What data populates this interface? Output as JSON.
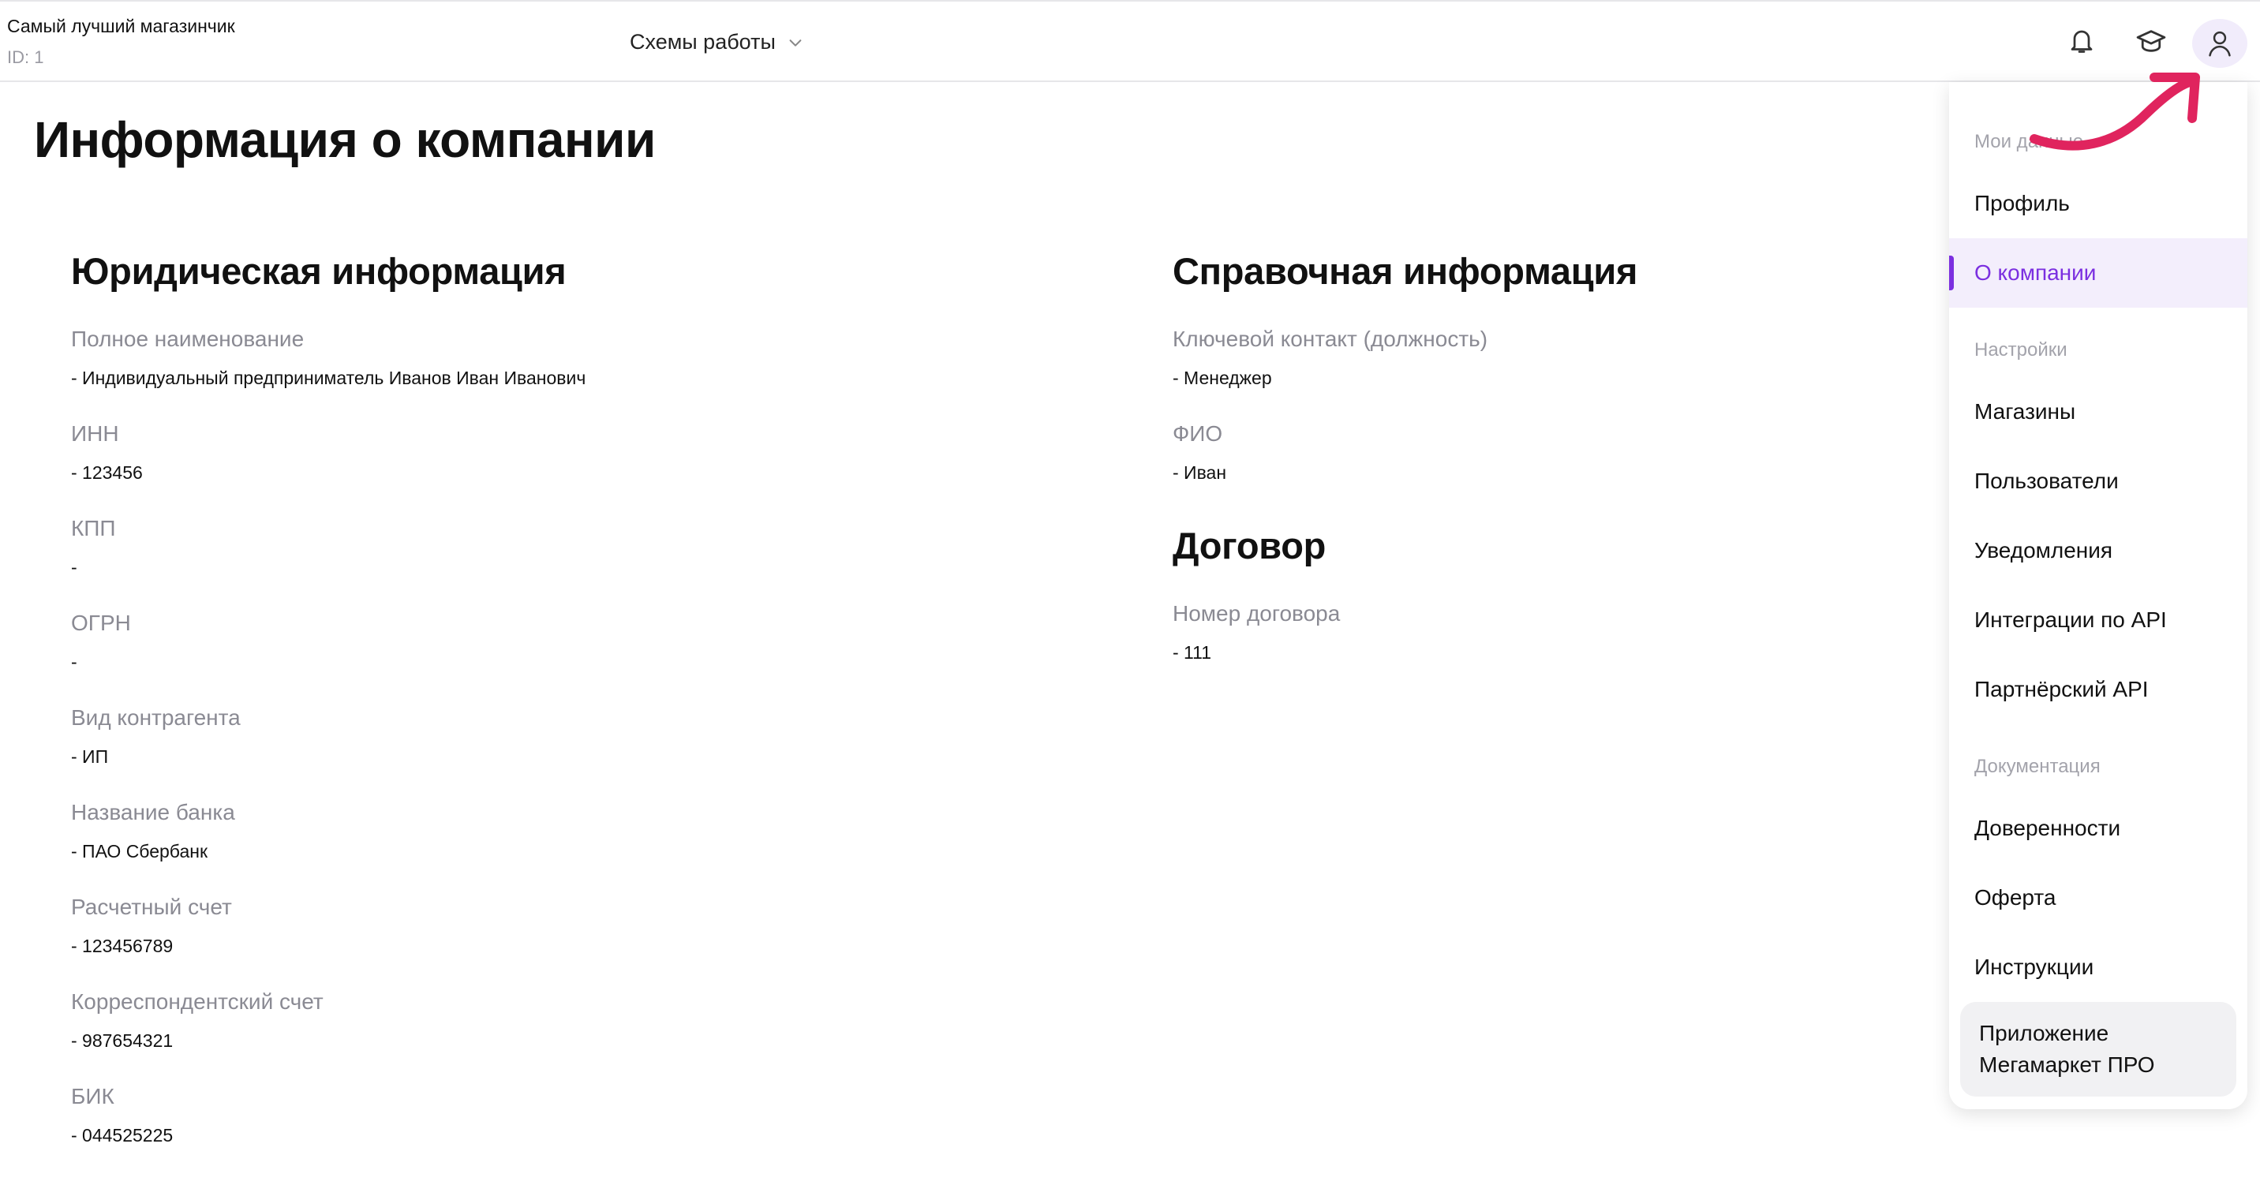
{
  "header": {
    "shop_name": "Самый лучший магазинчик",
    "shop_id": "ID: 1",
    "schemes_label": "Схемы работы"
  },
  "page": {
    "title": "Информация о компании"
  },
  "legal": {
    "title": "Юридическая информация",
    "fields": [
      {
        "label": "Полное наименование",
        "value": "- Индивидуальный предприниматель Иванов Иван Иванович"
      },
      {
        "label": "ИНН",
        "value": "- 123456"
      },
      {
        "label": "КПП",
        "value": "-"
      },
      {
        "label": "ОГРН",
        "value": "-"
      },
      {
        "label": "Вид контрагента",
        "value": "- ИП"
      },
      {
        "label": "Название банка",
        "value": "- ПАО Сбербанк"
      },
      {
        "label": "Расчетный счет",
        "value": "- 123456789"
      },
      {
        "label": "Корреспондентский счет",
        "value": "- 987654321"
      },
      {
        "label": "БИК",
        "value": "- 044525225"
      }
    ]
  },
  "reference": {
    "title": "Справочная информация",
    "fields": [
      {
        "label": "Ключевой контакт (должность)",
        "value": "- Менеджер"
      },
      {
        "label": "ФИО",
        "value": "- Иван"
      }
    ]
  },
  "contract": {
    "title": "Договор",
    "fields": [
      {
        "label": "Номер договора",
        "value": "- 111"
      }
    ]
  },
  "menu": {
    "group_my_data": "Мои данные",
    "profile": "Профиль",
    "about_company": "О компании",
    "group_settings": "Настройки",
    "shops": "Магазины",
    "users": "Пользователи",
    "notifications": "Уведомления",
    "api_integrations": "Интеграции по API",
    "partner_api": "Партнёрский API",
    "group_docs": "Документация",
    "powers_of_attorney": "Доверенности",
    "offer": "Оферта",
    "instructions": "Инструкции",
    "app_line1": "Приложение",
    "app_line2": "Мегамаркет ПРО"
  },
  "colors": {
    "accent": "#7b2fe0",
    "annotation_arrow": "#e0245e"
  }
}
